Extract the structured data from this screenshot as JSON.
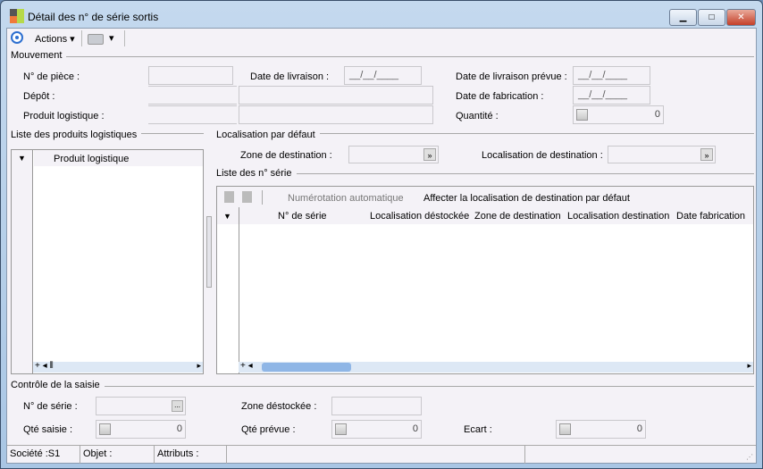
{
  "window": {
    "title": "Détail des n° de série sortis",
    "minimize": "▁",
    "maximize": "□",
    "close": "✕"
  },
  "toolbar": {
    "actions": "Actions",
    "print_arrow": "▾"
  },
  "mouvement": {
    "title": "Mouvement",
    "num_piece": "N° de pièce :",
    "date_livraison": "Date de livraison :",
    "date_livraison_value": "__/__/____",
    "date_livraison_prevue": "Date de livraison prévue :",
    "date_livraison_prevue_value": "__/__/____",
    "depot": "Dépôt :",
    "date_fabrication": "Date de fabrication :",
    "date_fabrication_value": "__/__/____",
    "produit_logistique": "Produit logistique :",
    "quantite": "Quantité :",
    "quantite_value": "0"
  },
  "produits": {
    "title": "Liste des produits logistiques",
    "column": "Produit logistique"
  },
  "localisation": {
    "title": "Localisation par défaut",
    "zone": "Zone de destination :",
    "localisation": "Localisation de destination :"
  },
  "series": {
    "title": "Liste des n° série",
    "auto": "Numérotation automatique",
    "affecter": "Affecter la localisation de destination par défaut",
    "columns": [
      "N° de série",
      "Localisation déstockée",
      "Zone de destination",
      "Localisation destination",
      "Date fabrication"
    ]
  },
  "controle": {
    "title": "Contrôle de la saisie",
    "num_serie": "N° de série :",
    "browse": "...",
    "zone_destockee": "Zone déstockée :",
    "qte_saisie": "Qté saisie :",
    "qte_saisie_value": "0",
    "qte_prevue": "Qté prévue :",
    "qte_prevue_value": "0",
    "ecart": "Ecart :",
    "ecart_value": "0"
  },
  "status": {
    "societe": "Société :S1",
    "objet": "Objet :",
    "attributs": "Attributs :"
  }
}
